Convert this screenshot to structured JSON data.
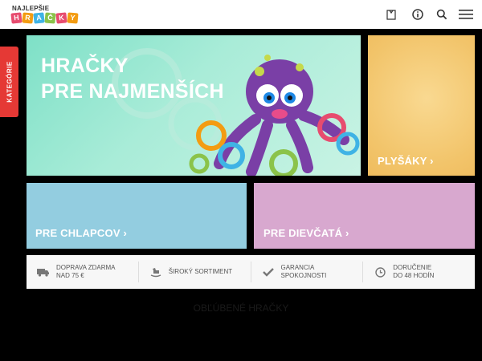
{
  "header": {
    "logo_top": "NAJLEPŠIE",
    "logo_letters": [
      "H",
      "R",
      "A",
      "Č",
      "K",
      "Y"
    ],
    "logo_colors": [
      "#e74c6f",
      "#f39c12",
      "#3fb3e5",
      "#8bc34a",
      "#e74c6f",
      "#f39c12"
    ],
    "icons": [
      "bag-icon",
      "info-icon",
      "search-icon",
      "menu-icon"
    ]
  },
  "sidebar": {
    "tab_label": "KATEGÓRIE"
  },
  "hero": {
    "line1": "HRAČKY",
    "line2": "PRE NAJMENŠÍCH"
  },
  "tiles": {
    "plush": "PLYŠÁKY ›",
    "boys": "PRE CHLAPCOV ›",
    "girls": "PRE DIEVČATÁ ›"
  },
  "features": [
    {
      "icon": "truck-icon",
      "line1": "DOPRAVA ZDARMA",
      "line2": "NAD 75 €"
    },
    {
      "icon": "rocking-horse-icon",
      "line1": "ŠIROKÝ SORTIMENT",
      "line2": ""
    },
    {
      "icon": "checkmark-icon",
      "line1": "GARANCIA",
      "line2": "SPOKOJNOSTI"
    },
    {
      "icon": "clock-icon",
      "line1": "DORUČENIE",
      "line2": "DO 48 HODÍN"
    }
  ],
  "section": {
    "title": "OBĽÚBENÉ HRAČKY"
  },
  "colors": {
    "accent": "#e53935",
    "hero": "#7ee0c7",
    "plush": "#f2c46a",
    "boys": "#93cde0",
    "girls": "#d8a8cf"
  }
}
